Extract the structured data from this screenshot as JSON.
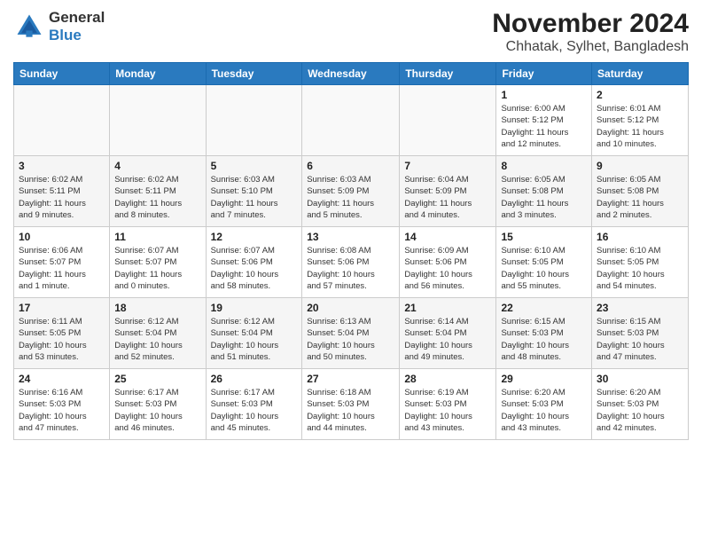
{
  "logo": {
    "line1": "General",
    "line2": "Blue"
  },
  "title": "November 2024",
  "subtitle": "Chhatak, Sylhet, Bangladesh",
  "header": {
    "days": [
      "Sunday",
      "Monday",
      "Tuesday",
      "Wednesday",
      "Thursday",
      "Friday",
      "Saturday"
    ]
  },
  "weeks": [
    [
      {
        "day": "",
        "info": ""
      },
      {
        "day": "",
        "info": ""
      },
      {
        "day": "",
        "info": ""
      },
      {
        "day": "",
        "info": ""
      },
      {
        "day": "",
        "info": ""
      },
      {
        "day": "1",
        "info": "Sunrise: 6:00 AM\nSunset: 5:12 PM\nDaylight: 11 hours\nand 12 minutes."
      },
      {
        "day": "2",
        "info": "Sunrise: 6:01 AM\nSunset: 5:12 PM\nDaylight: 11 hours\nand 10 minutes."
      }
    ],
    [
      {
        "day": "3",
        "info": "Sunrise: 6:02 AM\nSunset: 5:11 PM\nDaylight: 11 hours\nand 9 minutes."
      },
      {
        "day": "4",
        "info": "Sunrise: 6:02 AM\nSunset: 5:11 PM\nDaylight: 11 hours\nand 8 minutes."
      },
      {
        "day": "5",
        "info": "Sunrise: 6:03 AM\nSunset: 5:10 PM\nDaylight: 11 hours\nand 7 minutes."
      },
      {
        "day": "6",
        "info": "Sunrise: 6:03 AM\nSunset: 5:09 PM\nDaylight: 11 hours\nand 5 minutes."
      },
      {
        "day": "7",
        "info": "Sunrise: 6:04 AM\nSunset: 5:09 PM\nDaylight: 11 hours\nand 4 minutes."
      },
      {
        "day": "8",
        "info": "Sunrise: 6:05 AM\nSunset: 5:08 PM\nDaylight: 11 hours\nand 3 minutes."
      },
      {
        "day": "9",
        "info": "Sunrise: 6:05 AM\nSunset: 5:08 PM\nDaylight: 11 hours\nand 2 minutes."
      }
    ],
    [
      {
        "day": "10",
        "info": "Sunrise: 6:06 AM\nSunset: 5:07 PM\nDaylight: 11 hours\nand 1 minute."
      },
      {
        "day": "11",
        "info": "Sunrise: 6:07 AM\nSunset: 5:07 PM\nDaylight: 11 hours\nand 0 minutes."
      },
      {
        "day": "12",
        "info": "Sunrise: 6:07 AM\nSunset: 5:06 PM\nDaylight: 10 hours\nand 58 minutes."
      },
      {
        "day": "13",
        "info": "Sunrise: 6:08 AM\nSunset: 5:06 PM\nDaylight: 10 hours\nand 57 minutes."
      },
      {
        "day": "14",
        "info": "Sunrise: 6:09 AM\nSunset: 5:06 PM\nDaylight: 10 hours\nand 56 minutes."
      },
      {
        "day": "15",
        "info": "Sunrise: 6:10 AM\nSunset: 5:05 PM\nDaylight: 10 hours\nand 55 minutes."
      },
      {
        "day": "16",
        "info": "Sunrise: 6:10 AM\nSunset: 5:05 PM\nDaylight: 10 hours\nand 54 minutes."
      }
    ],
    [
      {
        "day": "17",
        "info": "Sunrise: 6:11 AM\nSunset: 5:05 PM\nDaylight: 10 hours\nand 53 minutes."
      },
      {
        "day": "18",
        "info": "Sunrise: 6:12 AM\nSunset: 5:04 PM\nDaylight: 10 hours\nand 52 minutes."
      },
      {
        "day": "19",
        "info": "Sunrise: 6:12 AM\nSunset: 5:04 PM\nDaylight: 10 hours\nand 51 minutes."
      },
      {
        "day": "20",
        "info": "Sunrise: 6:13 AM\nSunset: 5:04 PM\nDaylight: 10 hours\nand 50 minutes."
      },
      {
        "day": "21",
        "info": "Sunrise: 6:14 AM\nSunset: 5:04 PM\nDaylight: 10 hours\nand 49 minutes."
      },
      {
        "day": "22",
        "info": "Sunrise: 6:15 AM\nSunset: 5:03 PM\nDaylight: 10 hours\nand 48 minutes."
      },
      {
        "day": "23",
        "info": "Sunrise: 6:15 AM\nSunset: 5:03 PM\nDaylight: 10 hours\nand 47 minutes."
      }
    ],
    [
      {
        "day": "24",
        "info": "Sunrise: 6:16 AM\nSunset: 5:03 PM\nDaylight: 10 hours\nand 47 minutes."
      },
      {
        "day": "25",
        "info": "Sunrise: 6:17 AM\nSunset: 5:03 PM\nDaylight: 10 hours\nand 46 minutes."
      },
      {
        "day": "26",
        "info": "Sunrise: 6:17 AM\nSunset: 5:03 PM\nDaylight: 10 hours\nand 45 minutes."
      },
      {
        "day": "27",
        "info": "Sunrise: 6:18 AM\nSunset: 5:03 PM\nDaylight: 10 hours\nand 44 minutes."
      },
      {
        "day": "28",
        "info": "Sunrise: 6:19 AM\nSunset: 5:03 PM\nDaylight: 10 hours\nand 43 minutes."
      },
      {
        "day": "29",
        "info": "Sunrise: 6:20 AM\nSunset: 5:03 PM\nDaylight: 10 hours\nand 43 minutes."
      },
      {
        "day": "30",
        "info": "Sunrise: 6:20 AM\nSunset: 5:03 PM\nDaylight: 10 hours\nand 42 minutes."
      }
    ]
  ]
}
